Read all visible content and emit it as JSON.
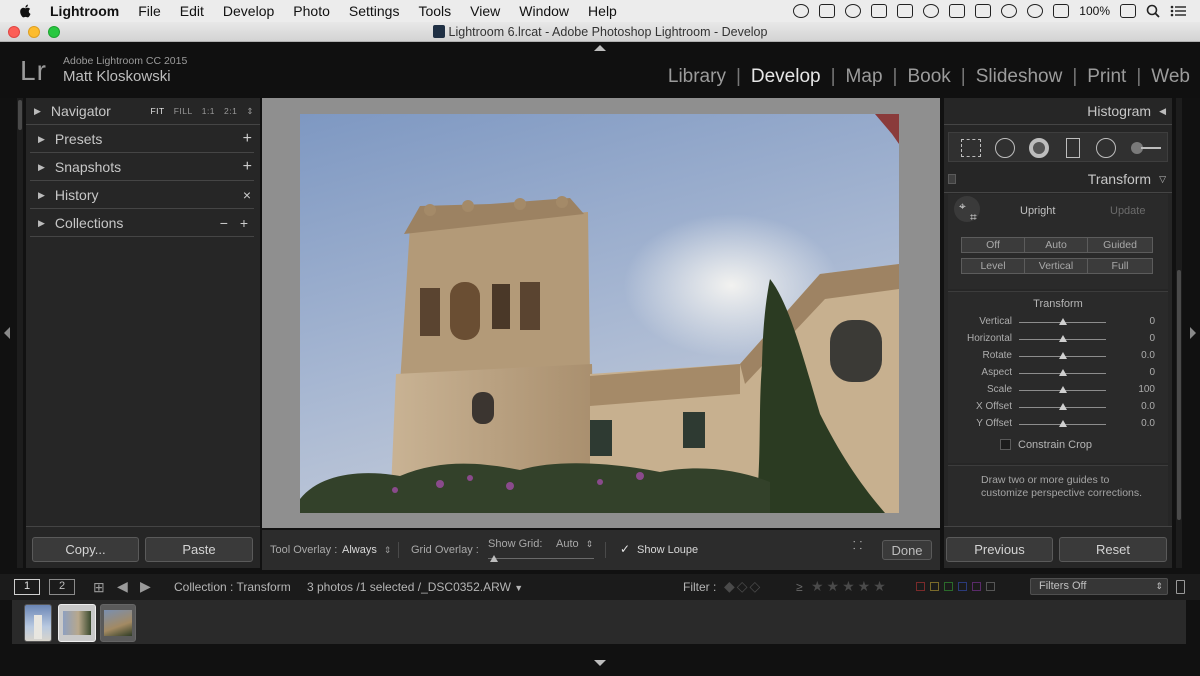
{
  "menubar": {
    "app_name": "Lightroom",
    "items": [
      "File",
      "Edit",
      "Develop",
      "Photo",
      "Settings",
      "Tools",
      "View",
      "Window",
      "Help"
    ],
    "battery": "100%"
  },
  "window": {
    "title": "Lightroom 6.lrcat - Adobe Photoshop Lightroom - Develop"
  },
  "identity": {
    "logo": "Lr",
    "product": "Adobe Lightroom CC 2015",
    "user": "Matt Kloskowski"
  },
  "modules": {
    "items": [
      "Library",
      "Develop",
      "Map",
      "Book",
      "Slideshow",
      "Print",
      "Web"
    ],
    "active": "Develop"
  },
  "left_panel": {
    "navigator": {
      "label": "Navigator",
      "zoom_options": [
        "FIT",
        "FILL",
        "1:1",
        "2:1"
      ]
    },
    "panels": [
      {
        "label": "Presets",
        "action": "+"
      },
      {
        "label": "Snapshots",
        "action": "+"
      },
      {
        "label": "History",
        "action": "×"
      },
      {
        "label": "Collections",
        "action": "− +"
      }
    ],
    "copy_label": "Copy...",
    "paste_label": "Paste"
  },
  "right_panel": {
    "histogram_label": "Histogram",
    "transform_label": "Transform",
    "upright": {
      "label": "Upright",
      "update_label": "Update",
      "row1": [
        "Off",
        "Auto",
        "Guided"
      ],
      "row2": [
        "Level",
        "Vertical",
        "Full"
      ]
    },
    "transform_section_label": "Transform",
    "sliders": [
      {
        "label": "Vertical",
        "value": "0"
      },
      {
        "label": "Horizontal",
        "value": "0"
      },
      {
        "label": "Rotate",
        "value": "0.0"
      },
      {
        "label": "Aspect",
        "value": "0"
      },
      {
        "label": "Scale",
        "value": "100"
      },
      {
        "label": "X Offset",
        "value": "0.0"
      },
      {
        "label": "Y Offset",
        "value": "0.0"
      }
    ],
    "constrain_crop_label": "Constrain Crop",
    "hint_line1": "Draw two or more guides to",
    "hint_line2": "customize perspective corrections.",
    "previous_label": "Previous",
    "reset_label": "Reset"
  },
  "toolbar": {
    "tool_overlay_label": "Tool Overlay :",
    "tool_overlay_value": "Always",
    "grid_overlay_label": "Grid Overlay :",
    "show_grid_label": "Show Grid:",
    "show_grid_value": "Auto",
    "show_loupe_label": "Show Loupe",
    "show_loupe_checked": true,
    "done_label": "Done"
  },
  "filmstrip_bar": {
    "screen1": "1",
    "screen2": "2",
    "collection": "Collection : Transform",
    "selection": "3 photos /1 selected /_DSC0352.ARW",
    "filter_label": "Filter :",
    "rating_op": "≥",
    "filters_off": "Filters Off"
  },
  "colors": {
    "panel_bg": "#262626",
    "canvas_bg": "#8f8f8f",
    "active_module": "#e6e6e6",
    "inactive_module": "#9b9b9b"
  }
}
